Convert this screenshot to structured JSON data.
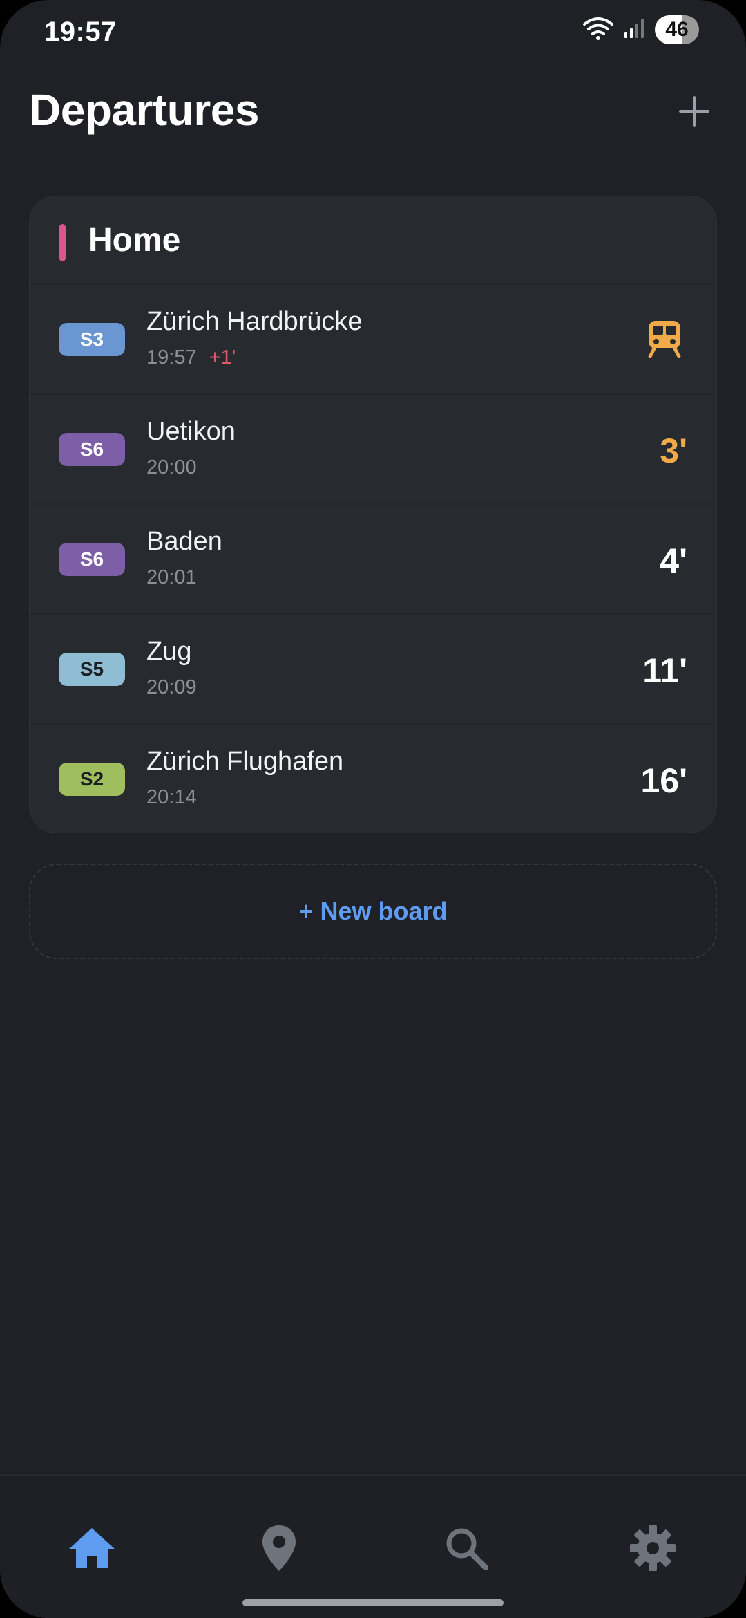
{
  "status_bar": {
    "time": "19:57",
    "battery": "46"
  },
  "header": {
    "title": "Departures",
    "add_icon": "plus-icon"
  },
  "board": {
    "name": "Home",
    "accent_color": "#d9578f",
    "departures": [
      {
        "line": "S3",
        "badge_color": "#6a96d2",
        "badge_text_color": "#ffffff",
        "destination": "Zürich Hardbrücke",
        "time": "19:57",
        "delay": "+1'",
        "status": "now",
        "status_icon": "train-icon"
      },
      {
        "line": "S6",
        "badge_color": "#7c5fa6",
        "badge_text_color": "#ffffff",
        "destination": "Uetikon",
        "time": "20:00",
        "delay": "",
        "minutes": "3'",
        "soon": true
      },
      {
        "line": "S6",
        "badge_color": "#7c5fa6",
        "badge_text_color": "#ffffff",
        "destination": "Baden",
        "time": "20:01",
        "delay": "",
        "minutes": "4'",
        "soon": false
      },
      {
        "line": "S5",
        "badge_color": "#8fbdd3",
        "badge_text_color": "#1b1e22",
        "destination": "Zug",
        "time": "20:09",
        "delay": "",
        "minutes": "11'",
        "soon": false
      },
      {
        "line": "S2",
        "badge_color": "#9fbf5f",
        "badge_text_color": "#1b1e22",
        "destination": "Zürich Flughafen",
        "time": "20:14",
        "delay": "",
        "minutes": "16'",
        "soon": false
      }
    ]
  },
  "new_board_label": "+ New board",
  "nav": {
    "items": [
      {
        "name": "home",
        "icon": "home-icon",
        "active": true
      },
      {
        "name": "nearby",
        "icon": "location-pin-icon",
        "active": false
      },
      {
        "name": "search",
        "icon": "search-icon",
        "active": false
      },
      {
        "name": "settings",
        "icon": "gear-icon",
        "active": false
      }
    ],
    "active_color": "#5e9cf0",
    "inactive_color": "#6f747c"
  },
  "colors": {
    "background": "#1f2126",
    "card": "#272b30",
    "accent_blue": "#5e9cf0",
    "delay_red": "#e05a66",
    "soon_orange": "#f0aa4a"
  }
}
